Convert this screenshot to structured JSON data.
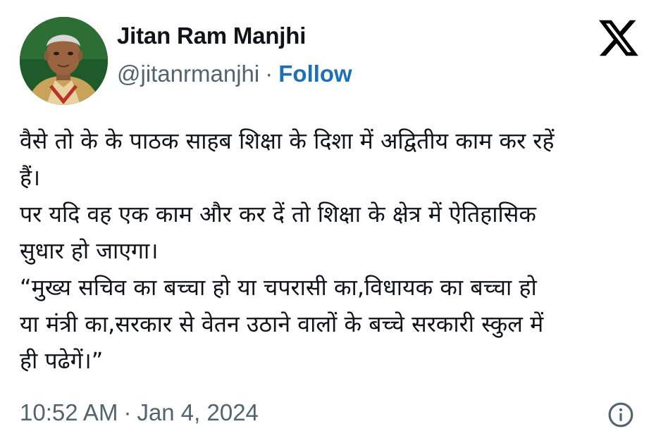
{
  "author": {
    "display_name": "Jitan Ram Manjhi",
    "handle": "@jitanrmanjhi",
    "separator": "·",
    "follow_label": "Follow",
    "avatar_icon": "profile-photo"
  },
  "platform": {
    "logo_icon": "x-logo"
  },
  "tweet": {
    "lines": [
      "वैसे तो के के पाठक साहब शिक्षा के दिशा में अद्वितीय काम कर रहें",
      "हैं।",
      "पर यदि वह एक काम और कर दें तो शिक्षा के क्षेत्र में ऐतिहासिक",
      "सुधार हो जाएगा।",
      "“मुख्य सचिव का बच्चा हो या चपरासी का,विधायक का बच्चा हो",
      "या मंत्री का,सरकार से वेतन उठाने वालों के बच्चे सरकारी स्कुल में",
      "ही पढेगें।”"
    ]
  },
  "meta": {
    "time": "10:52 AM",
    "separator": "·",
    "date": "Jan 4, 2024",
    "info_icon": "info-icon"
  },
  "colors": {
    "text": "#0f1419",
    "secondary": "#536471",
    "follow": "#1d6fb8",
    "avatar_background": "#1e5a2a"
  }
}
